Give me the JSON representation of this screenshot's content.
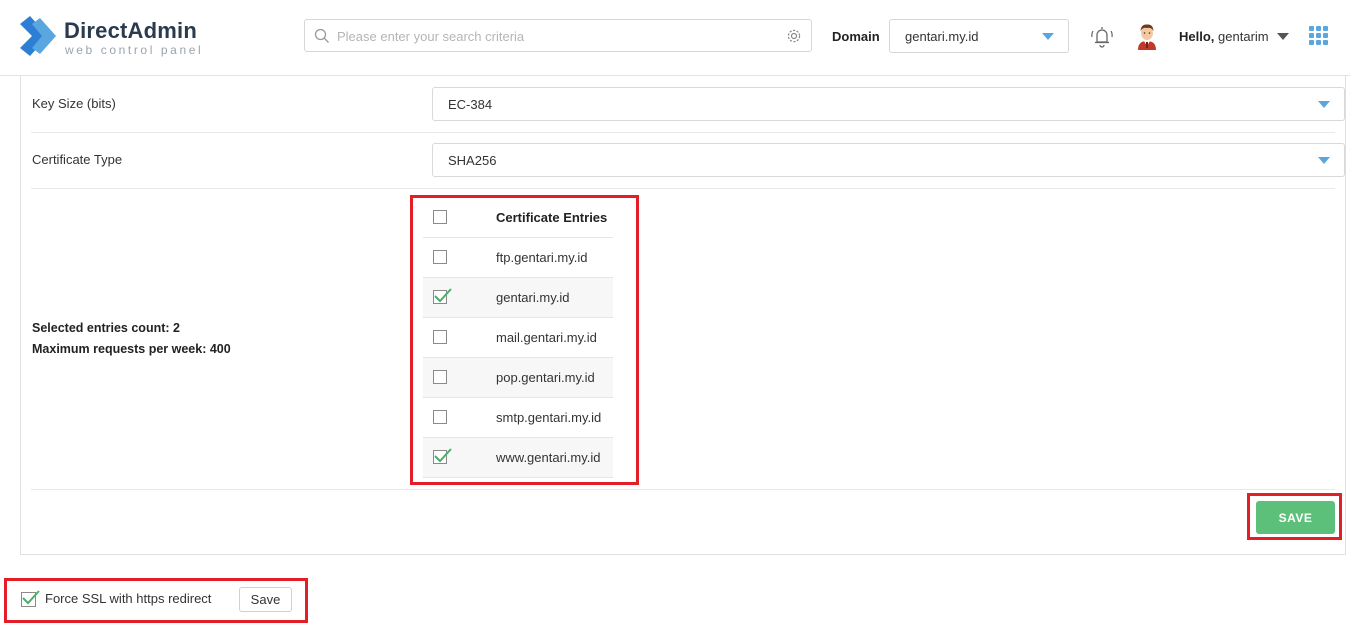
{
  "header": {
    "logo_title": "DirectAdmin",
    "logo_subtitle": "web control panel",
    "search_placeholder": "Please enter your search criteria",
    "domain_label": "Domain",
    "domain_value": "gentari.my.id",
    "hello_prefix": "Hello,",
    "username": "gentarim"
  },
  "form": {
    "key_size_label": "Key Size (bits)",
    "key_size_value": "EC-384",
    "cert_type_label": "Certificate Type",
    "cert_type_value": "SHA256",
    "selected_count_text": "Selected entries count: 2",
    "max_requests_text": "Maximum requests per week: 400",
    "entries_header": "Certificate Entries",
    "entries": [
      {
        "name": "ftp.gentari.my.id",
        "checked": false
      },
      {
        "name": "gentari.my.id",
        "checked": true
      },
      {
        "name": "mail.gentari.my.id",
        "checked": false
      },
      {
        "name": "pop.gentari.my.id",
        "checked": false
      },
      {
        "name": "smtp.gentari.my.id",
        "checked": false
      },
      {
        "name": "www.gentari.my.id",
        "checked": true
      }
    ],
    "save_label": "SAVE"
  },
  "force_ssl": {
    "label": "Force SSL with https redirect",
    "checked": true,
    "save_label": "Save"
  },
  "colors": {
    "accent_blue": "#5aa7e0",
    "save_green": "#5cc07a",
    "highlight_red": "#e31e26",
    "check_green": "#4cae6a"
  }
}
